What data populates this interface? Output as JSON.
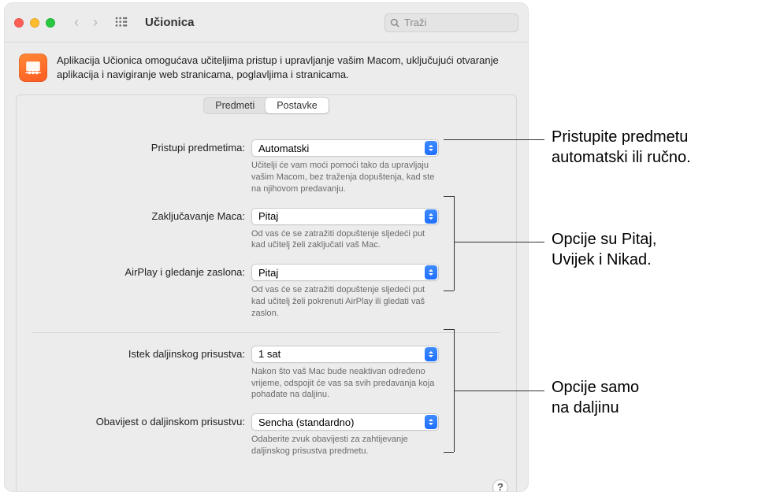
{
  "window": {
    "title": "Učionica",
    "search_placeholder": "Traži"
  },
  "header": {
    "description": "Aplikacija Učionica omogućava učiteljima pristup i upravljanje vašim Macom, uključujući otvaranje aplikacija i navigiranje web stranicama, poglavljima i stranicama."
  },
  "tabs": {
    "items_label": "Predmeti",
    "settings_label": "Postavke"
  },
  "form": {
    "join": {
      "label": "Pristupi predmetima:",
      "value": "Automatski",
      "desc": "Učitelji će vam moći pomoći tako da upravljaju vašim Macom, bez traženja dopuštenja, kad ste na njihovom predavanju."
    },
    "lock": {
      "label": "Zaključavanje Maca:",
      "value": "Pitaj",
      "desc": "Od vas će se zatražiti dopuštenje sljedeći put kad učitelj želi zaključati vaš Mac."
    },
    "airplay": {
      "label": "AirPlay i gledanje zaslona:",
      "value": "Pitaj",
      "desc": "Od vas će se zatražiti dopuštenje sljedeći put kad učitelj želi pokrenuti AirPlay ili gledati vaš zaslon."
    },
    "timeout": {
      "label": "Istek daljinskog prisustva:",
      "value": "1 sat",
      "desc": "Nakon što vaš Mac bude neaktivan određeno vrijeme, odspojit će vas sa svih predavanja koja pohađate na daljinu."
    },
    "sound": {
      "label": "Obavijest o daljinskom prisustvu:",
      "value": "Sencha (standardno)",
      "desc": "Odaberite zvuk obavijesti za zahtijevanje daljinskog prisustva predmetu."
    }
  },
  "help": {
    "label": "?"
  },
  "callouts": {
    "c1a": "Pristupite predmetu",
    "c1b": "automatski ili ručno.",
    "c2a": "Opcije su Pitaj,",
    "c2b": "Uvijek i Nikad.",
    "c3a": "Opcije samo",
    "c3b": "na daljinu"
  }
}
